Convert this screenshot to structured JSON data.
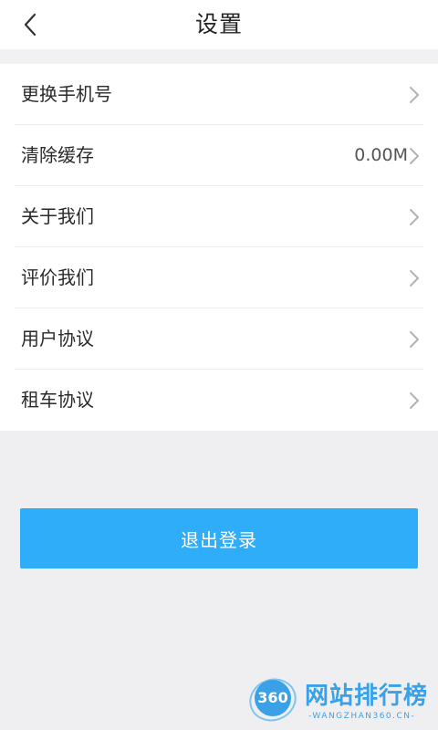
{
  "header": {
    "title": "设置",
    "back_icon": "chevron-left-icon"
  },
  "settings": {
    "items": [
      {
        "label": "更换手机号",
        "value": ""
      },
      {
        "label": "清除缓存",
        "value": "0.00M"
      },
      {
        "label": "关于我们",
        "value": ""
      },
      {
        "label": "评价我们",
        "value": ""
      },
      {
        "label": "用户协议",
        "value": ""
      },
      {
        "label": "租车协议",
        "value": ""
      }
    ],
    "chevron_icon": "chevron-right-icon"
  },
  "logout": {
    "label": "退出登录",
    "color": "#30adf8"
  },
  "watermark": {
    "badge_text": "360",
    "title": "网站排行榜",
    "subtitle": "-WANGZHAN360.CN-",
    "color": "#3aa1e6"
  }
}
